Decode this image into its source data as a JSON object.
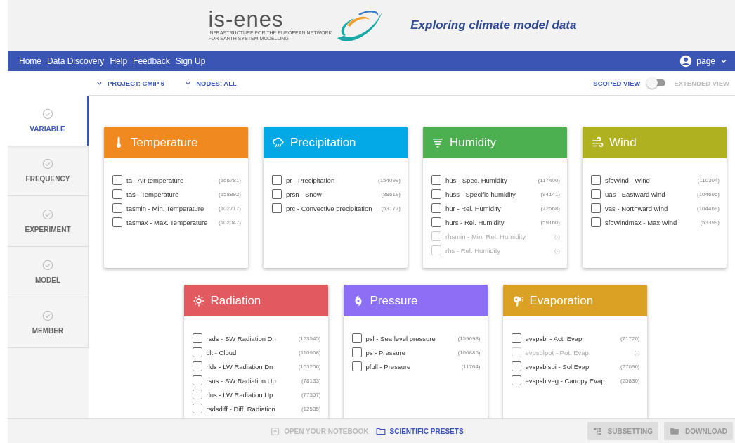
{
  "header": {
    "logo": {
      "name": "is-enes",
      "subtitle_lines": [
        "INFRASTRUCTURE FOR THE EUROPEAN NETWORK",
        "FOR EARTH SYSTEM MODELLING"
      ]
    },
    "tagline": "Exploring climate model data"
  },
  "nav": {
    "items": [
      "Home",
      "Data Discovery",
      "Help",
      "Feedback",
      "Sign Up"
    ],
    "user": "page"
  },
  "filters": [
    {
      "label": "PROJECT: CMIP 6"
    },
    {
      "label": "NODES: ALL"
    }
  ],
  "view_toggle": {
    "left_label": "SCOPED VIEW",
    "right_label": "EXTENDED VIEW",
    "on": false
  },
  "steps": [
    {
      "label": "VARIABLE",
      "selected": true
    },
    {
      "label": "FREQUENCY",
      "selected": false
    },
    {
      "label": "EXPERIMENT",
      "selected": false
    },
    {
      "label": "MODEL",
      "selected": false
    },
    {
      "label": "MEMBER",
      "selected": false
    }
  ],
  "cards": [
    {
      "title": "Temperature",
      "color": "#f0891f",
      "items": [
        {
          "label": "ta - Air temperature",
          "count": "(166781)",
          "checked": false,
          "disabled": false
        },
        {
          "label": "tas - Temperature",
          "count": "(158892)",
          "checked": false,
          "disabled": false
        },
        {
          "label": "tasmin - Min. Temperature",
          "count": "(102717)",
          "checked": false,
          "disabled": false
        },
        {
          "label": "tasmax - Max. Temperature",
          "count": "(102047)",
          "checked": false,
          "disabled": false
        }
      ]
    },
    {
      "title": "Precipitation",
      "color": "#03a9e4",
      "items": [
        {
          "label": "pr - Precipitation",
          "count": "(154099)",
          "checked": false,
          "disabled": false
        },
        {
          "label": "prsn - Snow",
          "count": "(88619)",
          "checked": false,
          "disabled": false
        },
        {
          "label": "prc - Convective precipitation",
          "count": "(53177)",
          "checked": false,
          "disabled": false
        }
      ]
    },
    {
      "title": "Humidity",
      "color": "#4caf50",
      "items": [
        {
          "label": "hus - Spec. Humidity",
          "count": "(117400)",
          "checked": false,
          "disabled": false
        },
        {
          "label": "huss - Specific humidity",
          "count": "(94141)",
          "checked": false,
          "disabled": false
        },
        {
          "label": "hur - Rel. Humidity",
          "count": "(72668)",
          "checked": false,
          "disabled": false
        },
        {
          "label": "hurs - Rel. Humidity",
          "count": "(59160)",
          "checked": false,
          "disabled": false
        },
        {
          "label": "rhsmin - Min, Rel. Humidity",
          "count": "(-)",
          "checked": false,
          "disabled": true
        },
        {
          "label": "rhs - Rel. Humidity",
          "count": "(-)",
          "checked": false,
          "disabled": true
        }
      ]
    },
    {
      "title": "Wind",
      "color": "#afb121",
      "items": [
        {
          "label": "sfcWind - Wind",
          "count": "(110304)",
          "checked": false,
          "disabled": false
        },
        {
          "label": "uas - Eastward wind",
          "count": "(104696)",
          "checked": false,
          "disabled": false
        },
        {
          "label": "vas - Northward wind",
          "count": "(104469)",
          "checked": false,
          "disabled": false
        },
        {
          "label": "sfcWindmax - Max Wind",
          "count": "(53399)",
          "checked": false,
          "disabled": false
        }
      ]
    },
    {
      "title": "Radiation",
      "color": "#e15a60",
      "items": [
        {
          "label": "rsds - SW Radiation Dn",
          "count": "(123545)",
          "checked": false,
          "disabled": false
        },
        {
          "label": "clt - Cloud",
          "count": "(110968)",
          "checked": false,
          "disabled": false
        },
        {
          "label": "rlds - LW Radiation Dn",
          "count": "(103206)",
          "checked": false,
          "disabled": false
        },
        {
          "label": "rsus - SW Radiation Up",
          "count": "(78133)",
          "checked": false,
          "disabled": false
        },
        {
          "label": "rlus - LW Radiation Up",
          "count": "(77357)",
          "checked": false,
          "disabled": false
        },
        {
          "label": "rsdsdiff - Diff. Radiation",
          "count": "(12535)",
          "checked": false,
          "disabled": false
        }
      ]
    },
    {
      "title": "Pressure",
      "color": "#8c6ff5",
      "items": [
        {
          "label": "psl - Sea level pressure",
          "count": "(159698)",
          "checked": false,
          "disabled": false
        },
        {
          "label": "ps - Pressure",
          "count": "(106885)",
          "checked": false,
          "disabled": false
        },
        {
          "label": "pfull - Pressure",
          "count": "(11704)",
          "checked": false,
          "disabled": false
        }
      ]
    },
    {
      "title": "Evaporation",
      "color": "#dba124",
      "items": [
        {
          "label": "evspsbl - Act. Evap.",
          "count": "(71720)",
          "checked": false,
          "disabled": false
        },
        {
          "label": "evpsblpot - Pot. Evap.",
          "count": "(-)",
          "checked": false,
          "disabled": true
        },
        {
          "label": "evspsblsoi - Sol Evap.",
          "count": "(27096)",
          "checked": false,
          "disabled": false
        },
        {
          "label": "evspsblveg - Canopy Evap.",
          "count": "(25830)",
          "checked": false,
          "disabled": false
        }
      ]
    }
  ],
  "footer": {
    "links": [
      {
        "label": "OPEN YOUR NOTEBOOK",
        "disabled": true
      },
      {
        "label": "SCIENTIFIC PRESETS",
        "disabled": false
      }
    ],
    "buttons": [
      {
        "label": "SUBSETTING",
        "disabled": true
      },
      {
        "label": "DOWNLOAD",
        "disabled": true
      }
    ]
  }
}
